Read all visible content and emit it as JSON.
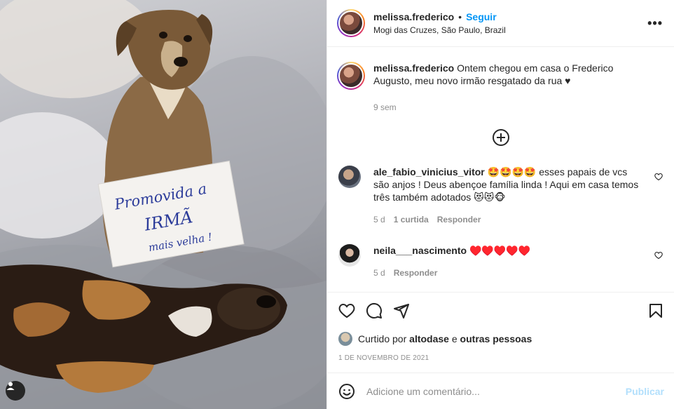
{
  "post": {
    "author": "melissa.frederico",
    "dot": "•",
    "follow_label": "Seguir",
    "location": "Mogi das Cruzes, São Paulo, Brazil",
    "more_label": "•••",
    "photo_sign_lines": [
      "Promovida a",
      "IRMÃ",
      "mais velha !"
    ]
  },
  "caption": {
    "author": "melissa.frederico",
    "text": "Ontem chegou em casa o Frederico Augusto, meu novo irmão resgatado da rua ♥",
    "time": "9 sem"
  },
  "comments": [
    {
      "author": "ale_fabio_vinicius_vitor",
      "text": "🤩🤩🤩🤩 esses papais de vcs são anjos ! Deus abençoe família linda ! Aqui em casa temos três também adotados 😻😻🐵",
      "time": "5 d",
      "likes": "1 curtida",
      "reply": "Responder"
    },
    {
      "author": "neila___nascimento",
      "text": "♥️♥️♥️♥️♥️",
      "time": "5 d",
      "reply": "Responder"
    }
  ],
  "likes": {
    "prefix": "Curtido por",
    "user": "altodase",
    "joiner": "e",
    "others": "outras pessoas"
  },
  "date": "1 DE NOVEMBRO DE 2021",
  "composer": {
    "placeholder": "Adicione um comentário...",
    "publish_label": "Publicar"
  },
  "colors": {
    "accent": "#0095f6",
    "publish_disabled": "#b2dffc",
    "muted": "#8e8e8e",
    "text": "#262626"
  },
  "icons": [
    "user-tag-icon",
    "ellipsis-icon",
    "add-circle-icon",
    "heart-outline-icon",
    "comment-icon",
    "share-icon",
    "bookmark-icon",
    "emoji-icon"
  ]
}
